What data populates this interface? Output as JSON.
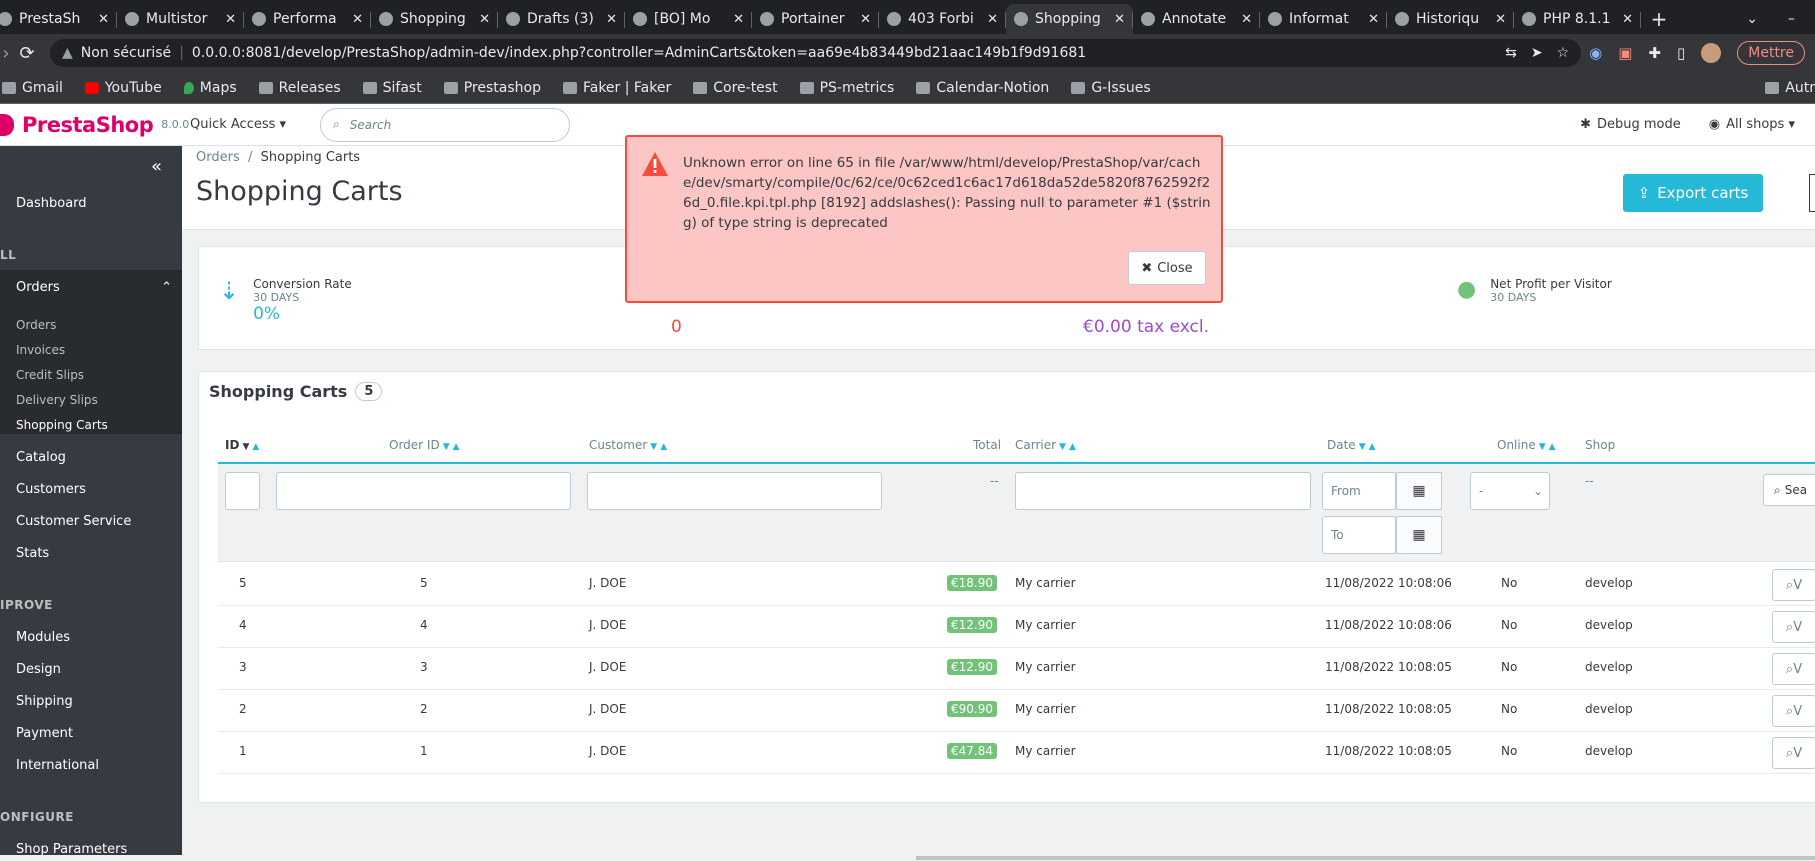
{
  "browser": {
    "tabs": [
      {
        "label": "PrestaSh"
      },
      {
        "label": "Multistor"
      },
      {
        "label": "Performa"
      },
      {
        "label": "Shopping"
      },
      {
        "label": "Drafts (3)"
      },
      {
        "label": "[BO] Mo"
      },
      {
        "label": "Portainer"
      },
      {
        "label": "403 Forbi"
      },
      {
        "label": "Shopping"
      },
      {
        "label": "Annotate"
      },
      {
        "label": "Informat"
      },
      {
        "label": "Historiqu"
      },
      {
        "label": "PHP 8.1.1"
      }
    ],
    "active_tab_index": 8,
    "address": {
      "security": "Non sécurisé",
      "url": "0.0.0.0:8081/develop/PrestaShop/admin-dev/index.php?controller=AdminCarts&token=aa69e4b83449bd21aac149b1f9d91681"
    },
    "mettre_label": "Mettre",
    "bookmarks": [
      "Gmail",
      "YouTube",
      "Maps",
      "Releases",
      "Sifast",
      "Prestashop",
      "Faker | Faker",
      "Core-test",
      "PS-metrics",
      "Calendar-Notion",
      "G-Issues"
    ],
    "bookmarks_more": "Autr"
  },
  "header": {
    "brand": "PrestaShop",
    "version": "8.0.0",
    "quick_access": "Quick Access ▾",
    "search_placeholder": "Search",
    "debug_mode": "Debug mode",
    "all_shops": "All shops ▾"
  },
  "sidebar": {
    "dashboard": "Dashboard",
    "sell_section": "LL",
    "orders": "Orders",
    "orders_sub": [
      "Orders",
      "Invoices",
      "Credit Slips",
      "Delivery Slips",
      "Shopping Carts"
    ],
    "catalog": "Catalog",
    "customers": "Customers",
    "customer_service": "Customer Service",
    "stats": "Stats",
    "improve_section": "IPROVE",
    "modules": "Modules",
    "design": "Design",
    "shipping": "Shipping",
    "payment": "Payment",
    "international": "International",
    "configure_section": "ONFIGURE",
    "shop_parameters": "Shop Parameters"
  },
  "toolbar": {
    "breadcrumb_parent": "Orders",
    "breadcrumb_current": "Shopping Carts",
    "title": "Shopping Carts",
    "export_label": "Export carts"
  },
  "kpis": {
    "conversion_label": "Conversion Rate",
    "conversion_sub": "30 DAYS",
    "conversion_value": "0%",
    "abandoned_value": "0",
    "avg_value": "€0.00 tax excl.",
    "profit_label": "Net Profit per Visitor",
    "profit_sub": "30 DAYS"
  },
  "panel": {
    "title": "Shopping Carts",
    "count": "5",
    "columns": {
      "id": "ID",
      "order_id": "Order ID",
      "customer": "Customer",
      "total": "Total",
      "carrier": "Carrier",
      "date": "Date",
      "online": "Online",
      "shop": "Shop"
    },
    "filters": {
      "total_placeholder": "--",
      "date_from": "From",
      "date_to": "To",
      "online_value": "-",
      "shop_placeholder": "--",
      "search_label": "Sea"
    },
    "rows": [
      {
        "id": "5",
        "order_id": "5",
        "customer": "J. DOE",
        "total": "€18.90",
        "carrier": "My carrier",
        "date": "11/08/2022 10:08:06",
        "online": "No",
        "shop": "develop"
      },
      {
        "id": "4",
        "order_id": "4",
        "customer": "J. DOE",
        "total": "€12.90",
        "carrier": "My carrier",
        "date": "11/08/2022 10:08:06",
        "online": "No",
        "shop": "develop"
      },
      {
        "id": "3",
        "order_id": "3",
        "customer": "J. DOE",
        "total": "€12.90",
        "carrier": "My carrier",
        "date": "11/08/2022 10:08:05",
        "online": "No",
        "shop": "develop"
      },
      {
        "id": "2",
        "order_id": "2",
        "customer": "J. DOE",
        "total": "€90.90",
        "carrier": "My carrier",
        "date": "11/08/2022 10:08:05",
        "online": "No",
        "shop": "develop"
      },
      {
        "id": "1",
        "order_id": "1",
        "customer": "J. DOE",
        "total": "€47.84",
        "carrier": "My carrier",
        "date": "11/08/2022 10:08:05",
        "online": "No",
        "shop": "develop"
      }
    ],
    "view_label": "V"
  },
  "alert": {
    "message": "Unknown error on line 65 in file /var/www/html/develop/PrestaShop/var/cache/dev/smarty/compile/0c/62/ce/0c62ced1c6ac17d618da52de5820f8762592f26d_0.file.kpi.tpl.php [8192] addslashes(): Passing null to parameter #1 ($string) of type string is deprecated",
    "close_label": "Close"
  },
  "colors": {
    "brand_pink": "#df0067",
    "primary": "#25b9d7",
    "success_badge": "#72c279",
    "danger": "#f54c3e",
    "alert_bg": "#fbc6c3"
  }
}
